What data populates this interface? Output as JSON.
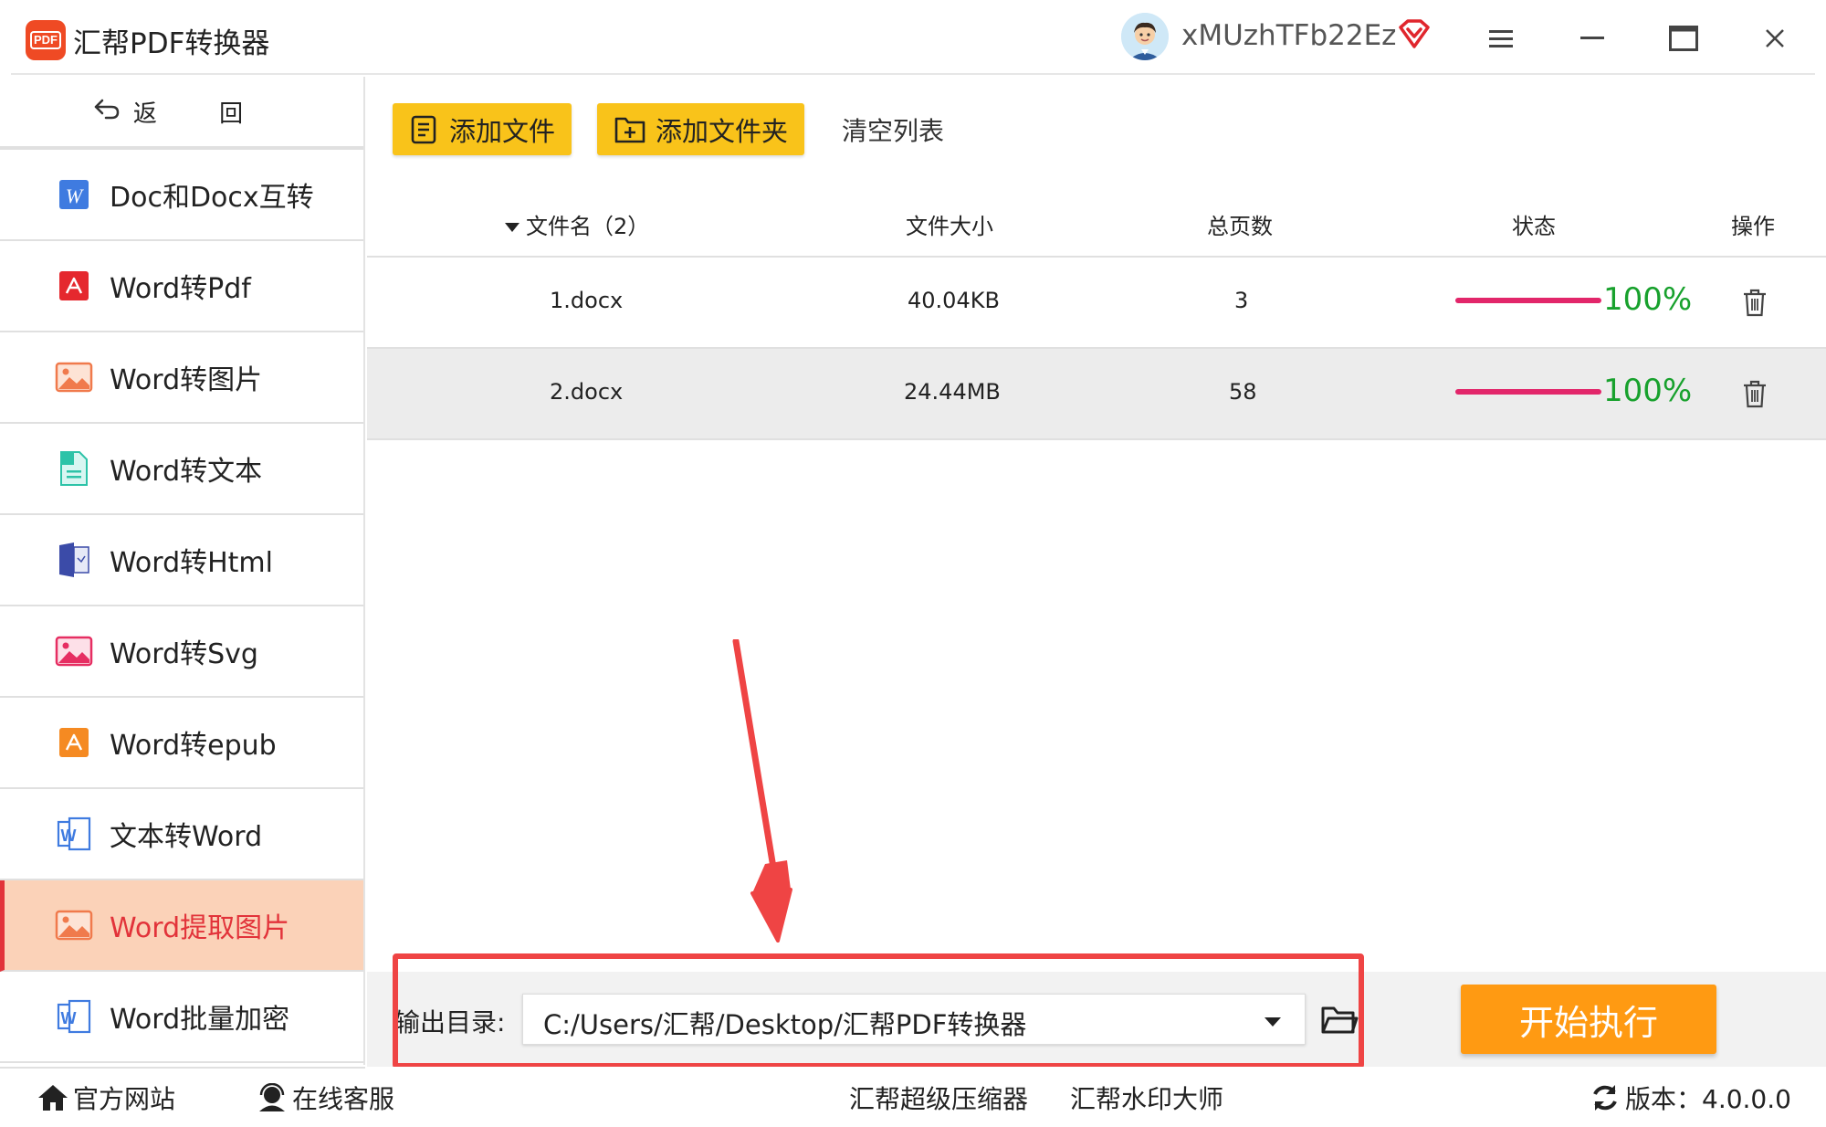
{
  "window": {
    "app_logo_text": "PDF",
    "title": "汇帮PDF转换器",
    "username": "xMUzhTFb22Ez"
  },
  "sidebar": {
    "back_label": "返 回",
    "items": [
      {
        "label": "Doc和Docx互转",
        "icon": "word-w-icon",
        "active": false
      },
      {
        "label": "Word转Pdf",
        "icon": "pdf-icon",
        "active": false
      },
      {
        "label": "Word转图片",
        "icon": "image-icon",
        "active": false
      },
      {
        "label": "Word转文本",
        "icon": "text-doc-icon",
        "active": false
      },
      {
        "label": "Word转Html",
        "icon": "html-doc-icon",
        "active": false
      },
      {
        "label": "Word转Svg",
        "icon": "svg-image-icon",
        "active": false
      },
      {
        "label": "Word转epub",
        "icon": "epub-icon",
        "active": false
      },
      {
        "label": "文本转Word",
        "icon": "word-outline-icon",
        "active": false
      },
      {
        "label": "Word提取图片",
        "icon": "image-icon",
        "active": true
      },
      {
        "label": "Word批量加密",
        "icon": "word-outline-icon",
        "active": false
      }
    ]
  },
  "toolbar": {
    "add_file": "添加文件",
    "add_folder": "添加文件夹",
    "clear_list": "清空列表"
  },
  "table": {
    "headers": {
      "filename": "文件名（2）",
      "size": "文件大小",
      "pages": "总页数",
      "status": "状态",
      "action": "操作"
    },
    "rows": [
      {
        "filename": "1.docx",
        "size": "40.04KB",
        "pages": "3",
        "progress": 100,
        "status": "100%"
      },
      {
        "filename": "2.docx",
        "size": "24.44MB",
        "pages": "58",
        "progress": 100,
        "status": "100%"
      }
    ]
  },
  "output": {
    "label": "输出目录:",
    "path": "C:/Users/汇帮/Desktop/汇帮PDF转换器",
    "start_button": "开始执行"
  },
  "footer": {
    "website": "官方网站",
    "support": "在线客服",
    "compressor": "汇帮超级压缩器",
    "watermark": "汇帮水印大师",
    "version": "版本：4.0.0.0"
  },
  "colors": {
    "accent_yellow": "#f9c31a",
    "start_orange": "#ff9a12",
    "active_bg": "#fbd2b8",
    "active_text": "#e2333a",
    "progress": "#e2266a",
    "percent_green": "#18a12d",
    "annotation_red": "#ef4444"
  }
}
